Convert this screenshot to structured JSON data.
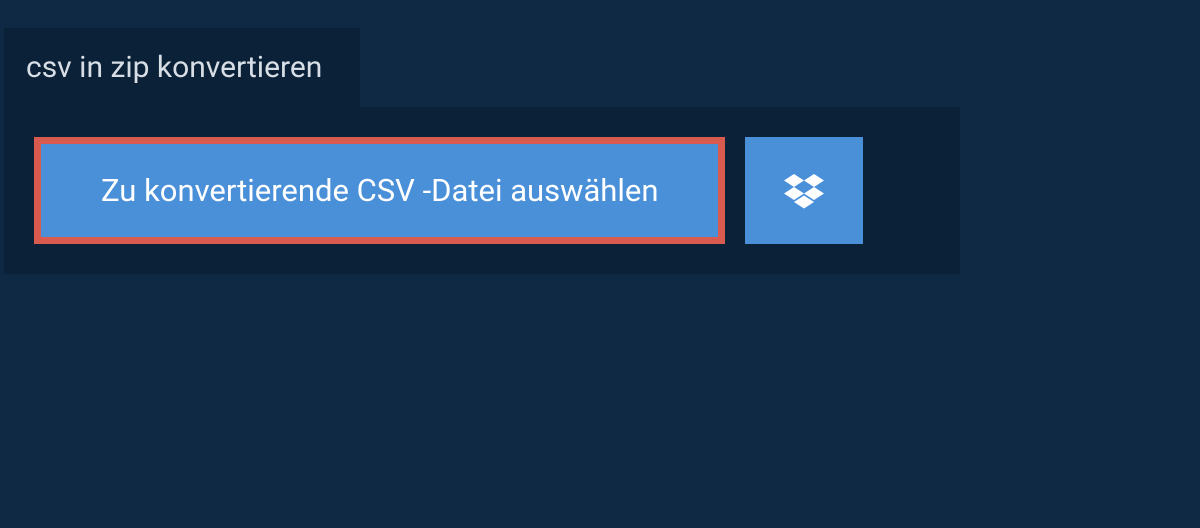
{
  "tab": {
    "title": "csv in zip konvertieren"
  },
  "actions": {
    "select_file_label": "Zu konvertierende CSV -Datei auswählen"
  }
}
